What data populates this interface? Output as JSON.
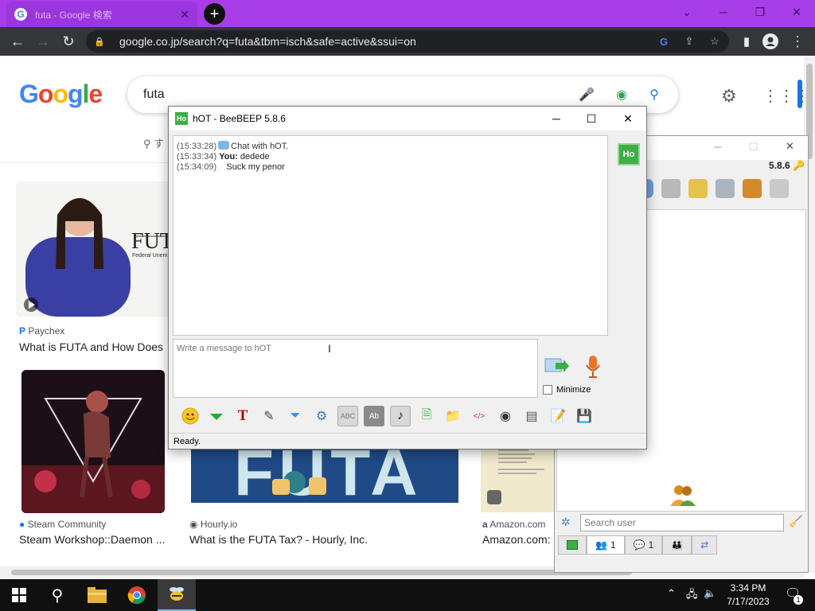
{
  "browser": {
    "tab_title": "futa - Google 検索",
    "url": "google.co.jp/search?q=futa&tbm=isch&safe=active&ssui=on"
  },
  "google": {
    "logo_text": "Google",
    "query": "futa",
    "results": [
      {
        "source": "Paychex",
        "title": "What is FUTA and How Does",
        "thumb_text": "FUTA",
        "thumb_subtext": "Federal Unem"
      },
      {
        "source": "Steam Community",
        "title": "Steam Workshop::Daemon ..."
      },
      {
        "source": "Hourly.io",
        "title": "What is the FUTA Tax? - Hourly, Inc.",
        "thumb_text": "FUTA"
      },
      {
        "source": "Amazon.com",
        "title": "Amazon.com:"
      }
    ]
  },
  "beebeep_main": {
    "version": "5.8.6",
    "search_placeholder": "Search user",
    "tabs": [
      {
        "icon": "users-icon",
        "count": "1"
      },
      {
        "icon": "chat-icon",
        "count": "1"
      }
    ]
  },
  "chat": {
    "title": "hOT - BeeBEEP 5.8.6",
    "avatar_text": "Ho",
    "messages": [
      {
        "time": "(15:33:28)",
        "sender": "",
        "text": "Chat with hOT."
      },
      {
        "time": "(15:33:34)",
        "sender": "You:",
        "text": "dedede"
      },
      {
        "time": "(15:34:09)",
        "sender": "",
        "text": "Suck my penor"
      }
    ],
    "compose_placeholder": "Write a message to hOT",
    "minimize_label": "Minimize",
    "status": "Ready."
  },
  "taskbar": {
    "time": "3:34 PM",
    "date": "7/17/2023",
    "notification_count": "1"
  }
}
